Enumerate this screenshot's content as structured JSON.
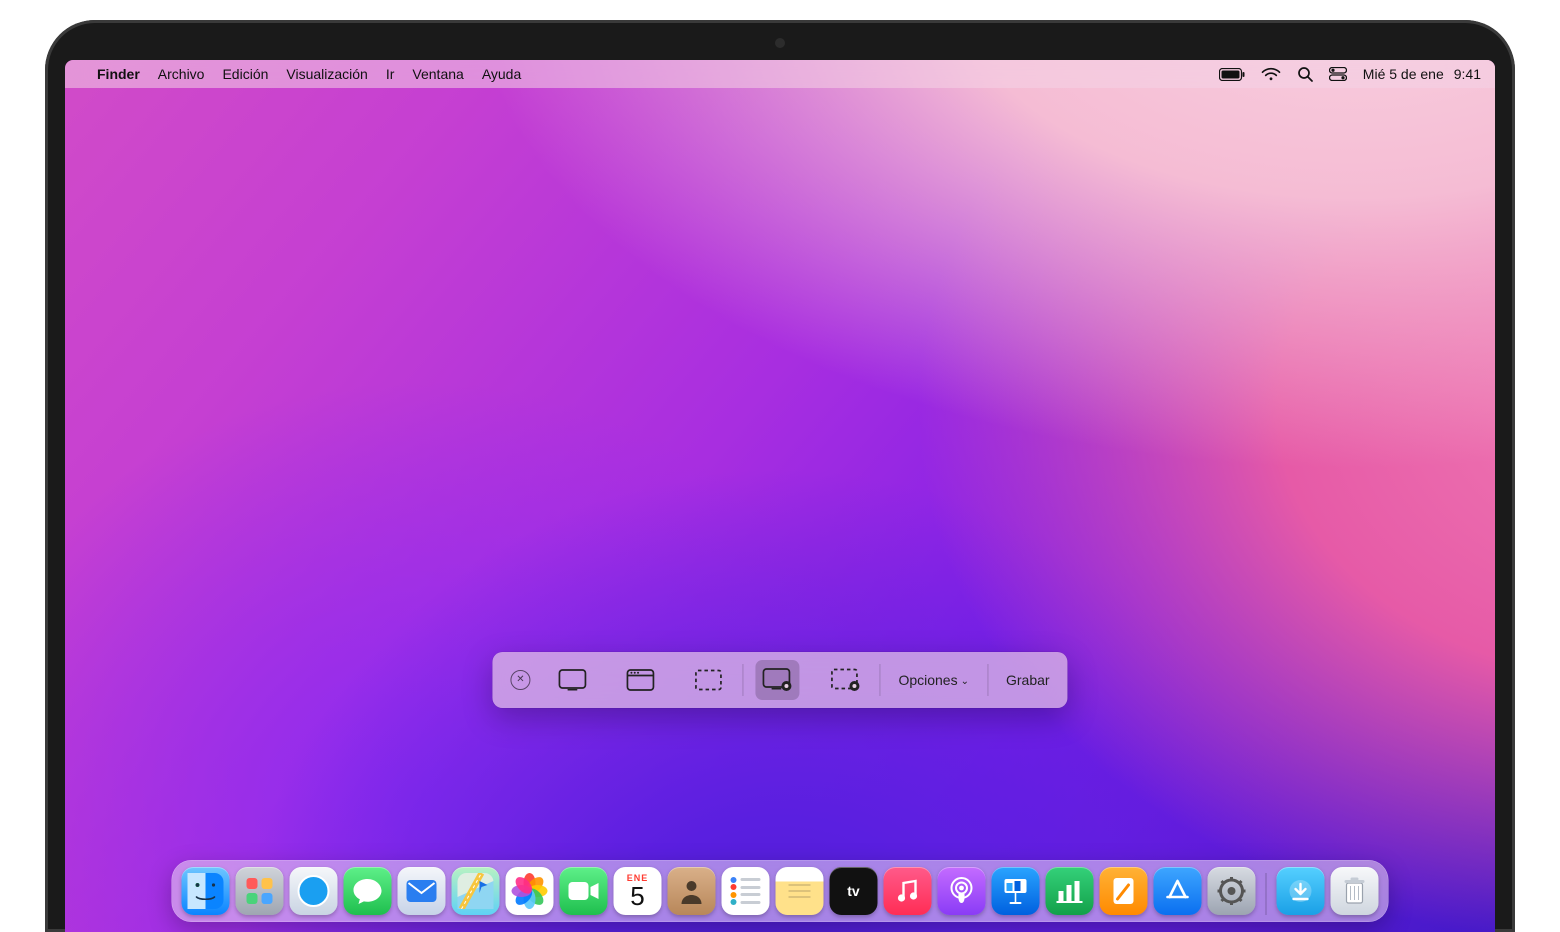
{
  "menubar": {
    "app_name": "Finder",
    "items": [
      "Archivo",
      "Edición",
      "Visualización",
      "Ir",
      "Ventana",
      "Ayuda"
    ],
    "status": {
      "date": "Mié 5 de ene",
      "time": "9:41"
    }
  },
  "screenshot_toolbar": {
    "options_label": "Opciones",
    "action_label": "Grabar",
    "modes": [
      {
        "id": "capture-entire-screen",
        "selected": false
      },
      {
        "id": "capture-window",
        "selected": false
      },
      {
        "id": "capture-selection",
        "selected": false
      },
      {
        "id": "record-entire-screen",
        "selected": true
      },
      {
        "id": "record-selection",
        "selected": false
      }
    ]
  },
  "calendar_tile": {
    "month_abbrev": "ENE",
    "day": "5"
  },
  "dock": {
    "apps": [
      "finder",
      "launchpad",
      "safari",
      "messages",
      "mail",
      "maps",
      "photos",
      "facetime",
      "calendar",
      "contacts",
      "reminders",
      "notes",
      "tv",
      "music",
      "podcasts",
      "keynote",
      "numbers",
      "pages",
      "appstore",
      "settings"
    ],
    "right": [
      "downloads",
      "trash"
    ]
  }
}
